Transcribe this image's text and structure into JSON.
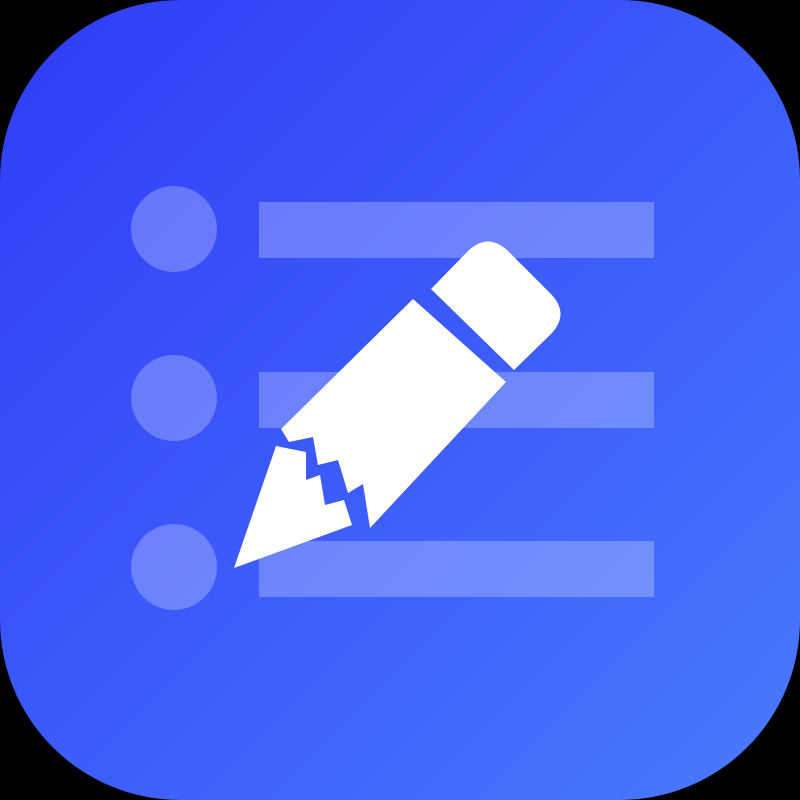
{
  "icon": {
    "name": "notes-list-edit-icon",
    "list_rows": 3,
    "colors": {
      "background": "#000000",
      "gradient_start": "#2f3cf8",
      "gradient_end": "#4a7afc",
      "list_marks": "#ffffff",
      "pencil": "#ffffff"
    }
  }
}
